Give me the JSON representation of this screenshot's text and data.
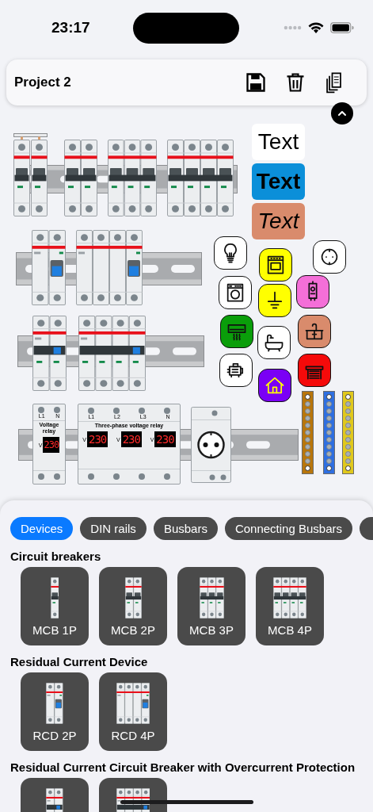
{
  "status_bar": {
    "time": "23:17"
  },
  "toolbar": {
    "title": "Project 2"
  },
  "canvas": {
    "rails": [
      {
        "devices": [
          {
            "kind": "mcb1p"
          },
          {
            "kind": "mcb1p"
          },
          {
            "kind": "mcb2p"
          },
          {
            "kind": "mcb3p"
          },
          {
            "kind": "mcb4p"
          }
        ]
      },
      {
        "devices": [
          {
            "kind": "rcd2p"
          },
          {
            "kind": "rcd4p"
          }
        ]
      },
      {
        "devices": [
          {
            "kind": "rcbo2p"
          },
          {
            "kind": "rcbo4p"
          }
        ]
      },
      {
        "devices": [
          {
            "kind": "relay",
            "title": "Voltage relay",
            "terminals": [
              "L1",
              "N"
            ],
            "channels": [
              {
                "unit": "V",
                "reading": "230"
              }
            ]
          },
          {
            "kind": "relay",
            "title": "Three-phase voltage relay",
            "terminals": [
              "L1",
              "L2",
              "L3",
              "N"
            ],
            "channels": [
              {
                "unit": "V",
                "reading": "230"
              },
              {
                "unit": "V",
                "reading": "230"
              },
              {
                "unit": "V",
                "reading": "230"
              }
            ]
          },
          {
            "kind": "socket"
          }
        ]
      }
    ],
    "connecting_busbars": [
      {
        "kind": "twopole"
      }
    ],
    "text_labels": [
      {
        "text": "Text",
        "kind": "plain",
        "color": "#ffffff"
      },
      {
        "text": "Text",
        "kind": "bold",
        "color": "#0b8fd9"
      },
      {
        "text": "Text",
        "kind": "italic",
        "color": "#d98b6c"
      }
    ],
    "appliances": [
      {
        "kind": "lightbulb",
        "color": "#ffffff"
      },
      {
        "kind": "oven",
        "color": "#ffff00"
      },
      {
        "kind": "socket",
        "color": "#ffffff"
      },
      {
        "kind": "washer",
        "color": "#ffffff"
      },
      {
        "kind": "earth",
        "color": "#ffff00"
      },
      {
        "kind": "heater",
        "color": "#f46fd8"
      },
      {
        "kind": "aircon",
        "color": "#0a9e0a"
      },
      {
        "kind": "bath",
        "color": "#ffffff"
      },
      {
        "kind": "sink",
        "color": "#d98b6c"
      },
      {
        "kind": "motor",
        "color": "#ffffff"
      },
      {
        "kind": "house",
        "color": "#7a00f5"
      },
      {
        "kind": "garage",
        "color": "#f50a0a"
      }
    ],
    "busbars": [
      {
        "color": "#b8760c"
      },
      {
        "color": "#2f6fe0"
      },
      {
        "color": "#e0c81c"
      }
    ]
  },
  "panel": {
    "tabs": [
      {
        "label": "Devices",
        "selected": true
      },
      {
        "label": "DIN rails",
        "selected": false
      },
      {
        "label": "Busbars",
        "selected": false
      },
      {
        "label": "Connecting Busbars",
        "selected": false
      },
      {
        "selected": false
      }
    ],
    "sections": [
      {
        "title": "Circuit breakers",
        "items": [
          {
            "kind": "mcb1p",
            "label": "MCB 1P"
          },
          {
            "kind": "mcb2p",
            "label": "MCB 2P"
          },
          {
            "kind": "mcb3p",
            "label": "MCB 3P"
          },
          {
            "kind": "mcb4p",
            "label": "MCB 4P"
          }
        ]
      },
      {
        "title": "Residual Current Device",
        "items": [
          {
            "kind": "rcd2p",
            "label": "RCD 2P"
          },
          {
            "kind": "rcd4p",
            "label": "RCD 4P"
          }
        ]
      },
      {
        "title": "Residual Current Circuit Breaker with Overcurrent Protection",
        "items": [
          {
            "kind": "rcbo2p"
          },
          {
            "kind": "rcbo4p"
          }
        ]
      }
    ]
  }
}
